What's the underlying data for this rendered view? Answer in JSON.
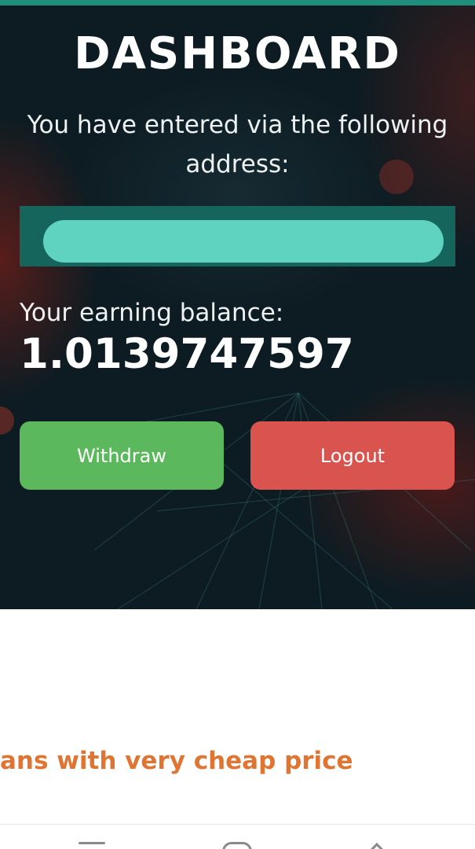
{
  "header": {
    "title": "DASHBOARD",
    "subtitle": "You have entered via the following address:"
  },
  "address": {
    "value": "",
    "redacted": true
  },
  "balance": {
    "label": "Your earning balance:",
    "value": "1.0139747597"
  },
  "actions": {
    "withdraw_label": "Withdraw",
    "logout_label": "Logout"
  },
  "promo": {
    "text": "ans with very cheap price"
  },
  "nav_bar": {
    "icons": [
      "menu-icon",
      "home-icon",
      "back-icon"
    ]
  },
  "colors": {
    "top_stripe": "#1f8e7a",
    "address_box": "#16655c",
    "address_mask": "#5fd3bf",
    "withdraw": "#5cb85c",
    "logout": "#d9534f",
    "promo_text": "#e07432"
  }
}
